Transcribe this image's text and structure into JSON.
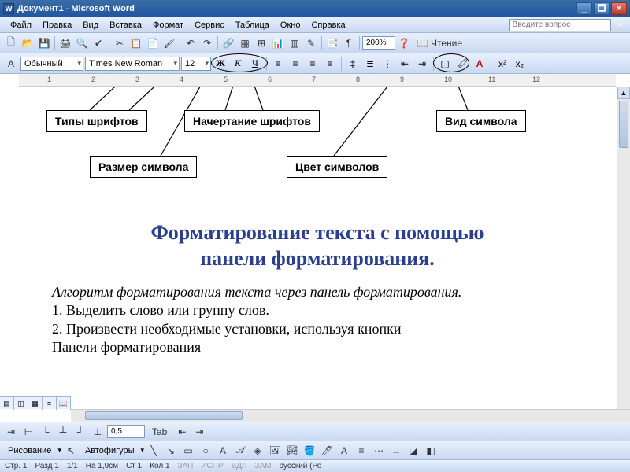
{
  "titlebar": {
    "title": "Документ1 - Microsoft Word"
  },
  "menu": {
    "file": "Файл",
    "edit": "Правка",
    "view": "Вид",
    "insert": "Вставка",
    "format": "Формат",
    "tools": "Сервис",
    "table": "Таблица",
    "window": "Окно",
    "help": "Справка",
    "help_placeholder": "Введите вопрос"
  },
  "toolbar": {
    "zoom": "200%",
    "read_label": "Чтение"
  },
  "format_bar": {
    "style": "Обычный",
    "font": "Times New Roman",
    "size": "12",
    "bold": "Ж",
    "italic": "К",
    "underline": "Ч"
  },
  "ruler": {
    "marks": [
      "1",
      "2",
      "3",
      "4",
      "5",
      "6",
      "7",
      "8",
      "9",
      "10",
      "11",
      "12"
    ]
  },
  "callouts": {
    "font_type": "Типы шрифтов",
    "font_size": "Размер символа",
    "font_style": "Начертание шрифтов",
    "font_color": "Цвет символов",
    "char_view": "Вид символа"
  },
  "doc": {
    "title_l1": "Форматирование текста с помощью",
    "title_l2": "панели форматирования.",
    "algo": "Алгоритм форматирования текста через панель форматирования.",
    "step1": "1. Выделить слово или группу слов.",
    "step2": "2. Произвести необходимые установки, используя кнопки",
    "step3": "Панели форматирования"
  },
  "bottom": {
    "line_spacing": "0,5",
    "tab": "Tab",
    "draw_label": "Рисование",
    "autoshapes": "Автофигуры"
  },
  "status": {
    "page": "Стр. 1",
    "section": "Разд 1",
    "pages": "1/1",
    "at": "На 1,9см",
    "line": "Ст 1",
    "col": "Кол 1",
    "zap": "ЗАП",
    "ispr": "ИСПР",
    "vdl": "ВДЛ",
    "zam": "ЗАМ",
    "lang": "русский (Ро"
  }
}
